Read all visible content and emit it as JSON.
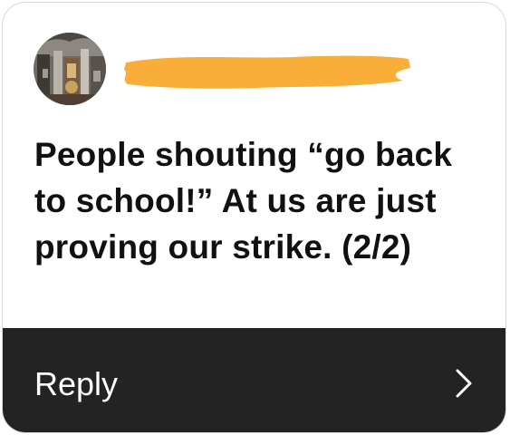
{
  "notification": {
    "avatar_icon": "profile-photo-icon",
    "sender_redacted": true,
    "message": "People shouting “go back to school!” At us are just proving our strike. (2/2)"
  },
  "reply": {
    "label": "Reply",
    "icon": "chevron-right-icon"
  },
  "colors": {
    "redaction": "#f9ae3a",
    "reply_bar": "#232323",
    "text": "#111111"
  }
}
